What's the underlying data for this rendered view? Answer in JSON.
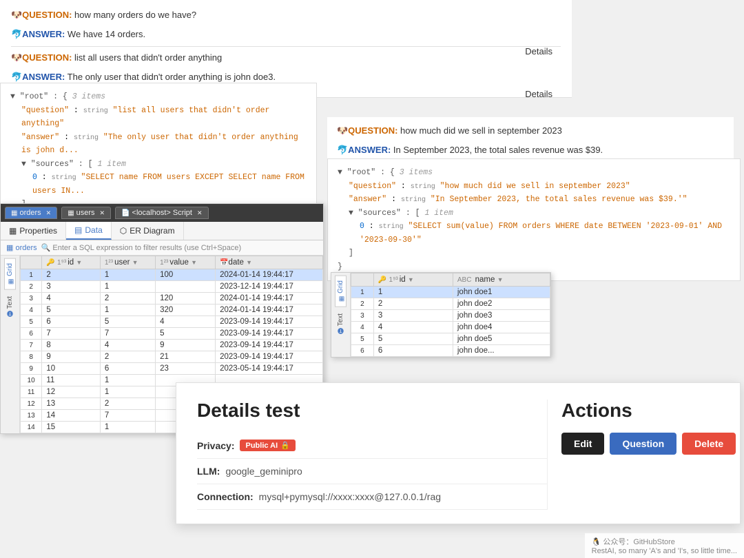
{
  "topPanel": {
    "qa1": {
      "question_label": "🐶QUESTION:",
      "question_text": " how many orders do we have?",
      "answer_label": "🐬ANSWER:",
      "answer_text": " We have 14 orders.",
      "details_link": "Details"
    },
    "qa2": {
      "question_label": "🐶QUESTION:",
      "question_text": " list all users that didn't order anything",
      "answer_label": "🐬ANSWER:",
      "answer_text": " The only user that didn't order anything is john doe3.",
      "details_link": "Details"
    }
  },
  "rightQA": {
    "question_label": "🐶QUESTION:",
    "question_text": " how much did we sell in september 2023",
    "answer_label": "🐬ANSWER:",
    "answer_text": " In September 2023, the total sales revenue was $39."
  },
  "jsonLeft": {
    "comment": "3 items",
    "question_key": "\"question\"",
    "question_type": "string",
    "question_val": "\"list all users that didn't order anything\"",
    "answer_key": "\"answer\"",
    "answer_type": "string",
    "answer_val": "\"The only user that didn't order anything is john d...",
    "sources_key": "\"sources\"",
    "sources_comment": "1 item",
    "source_index": "0",
    "source_type": "string",
    "source_val": "\"SELECT name FROM users EXCEPT SELECT name FROM users IN..."
  },
  "jsonRight": {
    "comment": "3 items",
    "question_key": "\"question\"",
    "question_type": "string",
    "question_val": "\"how much did we sell in september 2023\"",
    "answer_key": "\"answer\"",
    "answer_type": "string",
    "answer_val": "\"In September 2023, the total sales revenue was $39.'\"",
    "sources_key": "\"sources\"",
    "sources_comment": "1 item",
    "source_index": "0",
    "source_type": "string",
    "source_val": "\"SELECT sum(value) FROM orders WHERE date BETWEEN '2023-09-01' AND '2023-09-30'\""
  },
  "dbPanel": {
    "tabs": [
      "orders",
      "users",
      "<localhost> Script"
    ],
    "subTabs": [
      "Properties",
      "Data",
      "ER Diagram"
    ],
    "filterPlaceholder": "🔍 Enter a SQL expression to filter results (use Ctrl+Space)",
    "tableName": "orders",
    "columns": [
      {
        "icon": "🔑",
        "type": "1⃣9⃣3⃣",
        "name": "id",
        "sort": "▼"
      },
      {
        "icon": "",
        "type": "1⃣2⃣3⃣",
        "name": "user",
        "sort": "▼"
      },
      {
        "icon": "",
        "type": "1⃣2⃣3⃣",
        "name": "value",
        "sort": "▼"
      },
      {
        "icon": "📅",
        "type": "",
        "name": "date",
        "sort": "▼"
      }
    ],
    "rows": [
      {
        "num": 1,
        "id": 2,
        "user": 1,
        "value": 100,
        "date": "2024-01-14 19:44:17",
        "selected": true
      },
      {
        "num": 2,
        "id": 3,
        "user": 1,
        "value": "",
        "date": "2023-12-14 19:44:17"
      },
      {
        "num": 3,
        "id": 4,
        "user": 2,
        "value": 120,
        "date": "2024-01-14 19:44:17"
      },
      {
        "num": 4,
        "id": 5,
        "user": 1,
        "value": 320,
        "date": "2024-01-14 19:44:17"
      },
      {
        "num": 5,
        "id": 6,
        "user": 5,
        "value": 4,
        "date": "2023-09-14 19:44:17"
      },
      {
        "num": 6,
        "id": 7,
        "user": 7,
        "value": 5,
        "date": "2023-09-14 19:44:17"
      },
      {
        "num": 7,
        "id": 8,
        "user": 4,
        "value": 9,
        "date": "2023-09-14 19:44:17"
      },
      {
        "num": 8,
        "id": 9,
        "user": 2,
        "value": 21,
        "date": "2023-09-14 19:44:17"
      },
      {
        "num": 9,
        "id": 10,
        "user": 6,
        "value": 23,
        "date": "2023-05-14 19:44:17"
      },
      {
        "num": 10,
        "id": 11,
        "user": 1,
        "value": "",
        "date": ""
      },
      {
        "num": 11,
        "id": 12,
        "user": 1,
        "value": "",
        "date": ""
      },
      {
        "num": 12,
        "id": 13,
        "user": 2,
        "value": "",
        "date": ""
      },
      {
        "num": 13,
        "id": 14,
        "user": 7,
        "value": "",
        "date": ""
      },
      {
        "num": 14,
        "id": 15,
        "user": 1,
        "value": "",
        "date": ""
      }
    ],
    "sideTabs": [
      "Grid",
      "Text"
    ]
  },
  "usersPanel": {
    "tableName": "users",
    "columns": [
      {
        "icon": "🔑",
        "type": "1⃣9⃣3⃣",
        "name": "id",
        "sort": "▼"
      },
      {
        "icon": "🔤",
        "type": "",
        "name": "name",
        "sort": "▼"
      }
    ],
    "rows": [
      {
        "num": 1,
        "id": 1,
        "name": "john doe1",
        "selected": true
      },
      {
        "num": 2,
        "id": 2,
        "name": "john doe2"
      },
      {
        "num": 3,
        "id": 3,
        "name": "john doe3"
      },
      {
        "num": 4,
        "id": 4,
        "name": "john doe4"
      },
      {
        "num": 5,
        "id": 5,
        "name": "john doe5"
      },
      {
        "num": 6,
        "id": 6,
        "name": "john doe..."
      }
    ],
    "sideTabs": [
      "Grid",
      "Text"
    ]
  },
  "detailsPanel": {
    "title": "Details test",
    "actionsTitle": "Actions",
    "privacy_label": "Privacy:",
    "privacy_badge": "Public AI",
    "privacy_icon": "🔒",
    "llm_label": "LLM:",
    "llm_value": "google_geminipro",
    "connection_label": "Connection:",
    "connection_value": "mysql+pymysql://xxxx:xxxx@127.0.0.1/rag",
    "buttons": {
      "edit": "Edit",
      "question": "Question",
      "delete": "Delete"
    }
  },
  "watermark": {
    "text": "🐧 公众号：GitHubStore",
    "subtext": "RestAI, so many 'A's and 'I's, so little time..."
  }
}
